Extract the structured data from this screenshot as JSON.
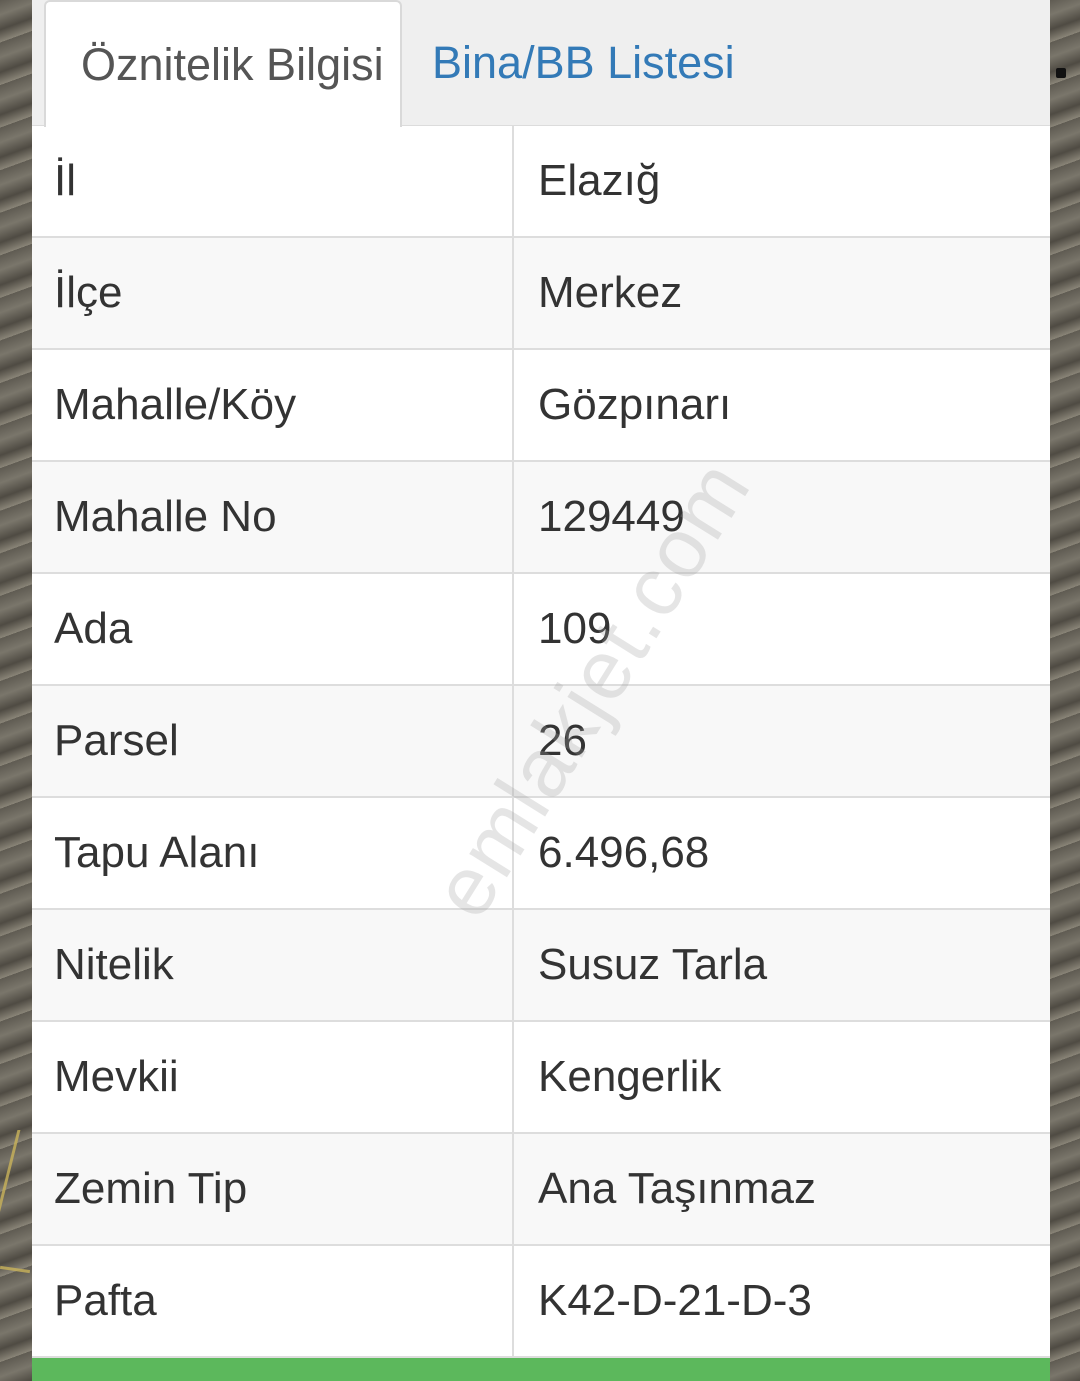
{
  "tabs": {
    "attribute_info": "Öznitelik Bilgisi",
    "building_list": "Bina/BB Listesi"
  },
  "rows": [
    {
      "key": "İl",
      "value": "Elazığ"
    },
    {
      "key": "İlçe",
      "value": "Merkez"
    },
    {
      "key": "Mahalle/Köy",
      "value": "Gözpınarı"
    },
    {
      "key": "Mahalle No",
      "value": "129449"
    },
    {
      "key": "Ada",
      "value": "109"
    },
    {
      "key": "Parsel",
      "value": "26"
    },
    {
      "key": "Tapu Alanı",
      "value": "6.496,68"
    },
    {
      "key": "Nitelik",
      "value": "Susuz Tarla"
    },
    {
      "key": "Mevkii",
      "value": "Kengerlik"
    },
    {
      "key": "Zemin Tip",
      "value": "Ana Taşınmaz"
    },
    {
      "key": "Pafta",
      "value": "K42-D-21-D-3"
    }
  ],
  "watermark": "emlakjet.com",
  "colors": {
    "tab_link": "#337ab7",
    "footer_accent": "#5cb85c"
  }
}
